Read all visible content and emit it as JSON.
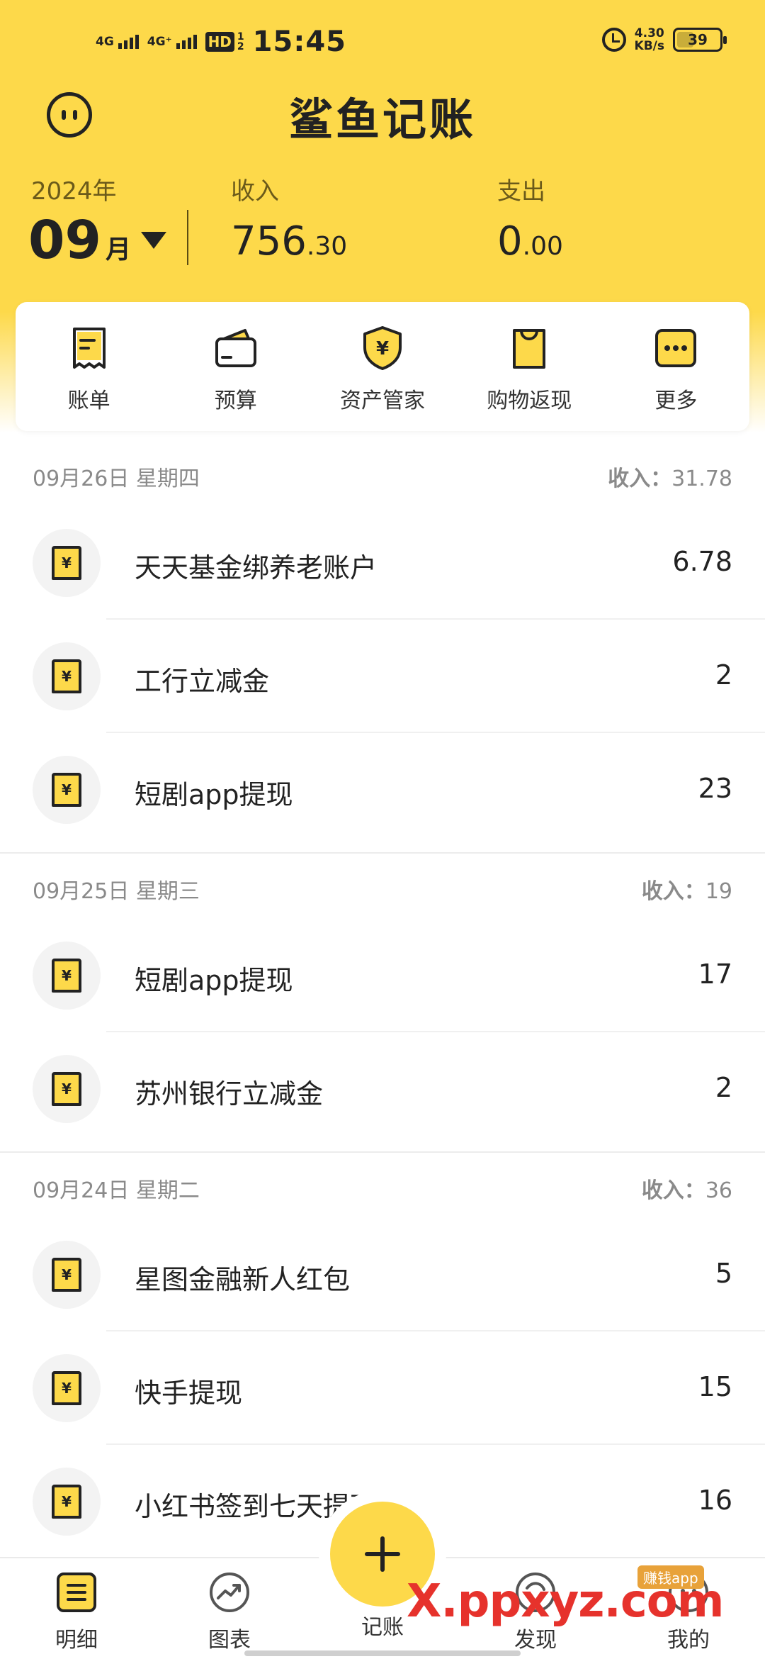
{
  "status_bar": {
    "net1": "4G",
    "net2": "4G⁺",
    "hd": "HD",
    "hd_sub1": "1",
    "hd_sub2": "2",
    "time": "15:45",
    "speed_value": "4.30",
    "speed_unit": "KB/s",
    "battery": "39",
    "battery_level_pct": 39
  },
  "header": {
    "title": "鲨鱼记账",
    "year": "2024年",
    "month_num": "09",
    "month_unit": "月",
    "income_label": "收入",
    "income_int": "756",
    "income_dec": ".30",
    "expense_label": "支出",
    "expense_int": "0",
    "expense_dec": ".00"
  },
  "quick_menu": [
    {
      "label": "账单",
      "icon": "bill-icon"
    },
    {
      "label": "预算",
      "icon": "wallet-icon"
    },
    {
      "label": "资产管家",
      "icon": "shield-yen-icon"
    },
    {
      "label": "购物返现",
      "icon": "shopping-bag-icon"
    },
    {
      "label": "更多",
      "icon": "more-icon"
    }
  ],
  "days": [
    {
      "date": "09月26日 星期四",
      "sum_label": "收入：",
      "sum_value": "31.78",
      "items": [
        {
          "name": "天天基金绑养老账户",
          "amount": "6.78"
        },
        {
          "name": "工行立减金",
          "amount": "2"
        },
        {
          "name": "短剧app提现",
          "amount": "23"
        }
      ]
    },
    {
      "date": "09月25日 星期三",
      "sum_label": "收入：",
      "sum_value": "19",
      "items": [
        {
          "name": "短剧app提现",
          "amount": "17"
        },
        {
          "name": "苏州银行立减金",
          "amount": "2"
        }
      ]
    },
    {
      "date": "09月24日 星期二",
      "sum_label": "收入：",
      "sum_value": "36",
      "items": [
        {
          "name": "星图金融新人红包",
          "amount": "5"
        },
        {
          "name": "快手提现",
          "amount": "15"
        },
        {
          "name": "小红书签到七天提现",
          "amount": "16"
        }
      ]
    }
  ],
  "receipt_glyph": "¥",
  "tabs": [
    {
      "label": "明细",
      "icon": "list-icon"
    },
    {
      "label": "图表",
      "icon": "chart-icon"
    },
    {
      "label": "记账",
      "icon": "add-icon"
    },
    {
      "label": "发现",
      "icon": "discover-icon"
    },
    {
      "label": "我的",
      "icon": "profile-icon"
    }
  ],
  "watermark": {
    "text": "X.ppxyz.com",
    "tag": "赚钱app"
  },
  "colors": {
    "brand_yellow": "#fdd94a",
    "text_dark": "#222222",
    "text_muted": "#8a8a8a"
  }
}
